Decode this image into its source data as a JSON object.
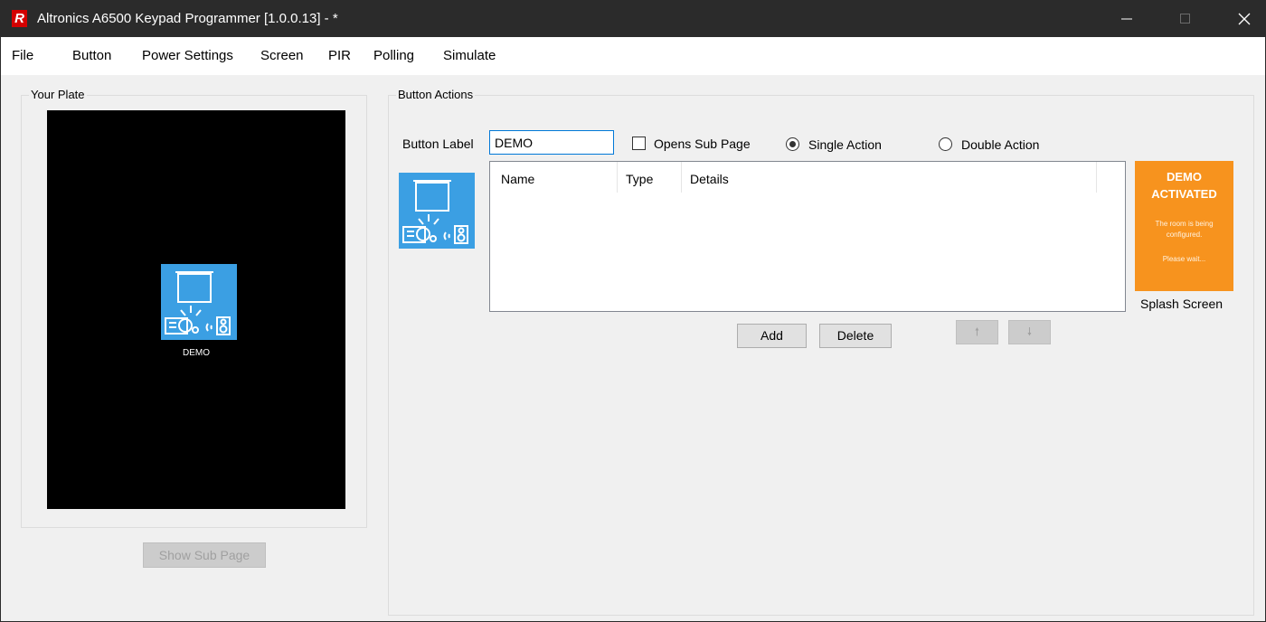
{
  "window": {
    "title": "Altronics A6500 Keypad Programmer [1.0.0.13]  - *",
    "app_icon_letter": "R"
  },
  "menu": [
    "File",
    "Button",
    "Power Settings",
    "Screen",
    "PIR",
    "Polling",
    "Simulate"
  ],
  "your_plate": {
    "title": "Your Plate",
    "button_label": "DEMO",
    "show_sub_page_label": "Show Sub Page",
    "show_sub_page_enabled": false
  },
  "button_actions": {
    "title": "Button Actions",
    "button_label_caption": "Button Label",
    "button_label_value": "DEMO",
    "opens_sub_page_label": "Opens Sub Page",
    "opens_sub_page_checked": false,
    "single_action_label": "Single Action",
    "double_action_label": "Double Action",
    "selected_action": "Single Action",
    "table_columns": [
      "Name",
      "Type",
      "Details"
    ],
    "table_rows": [],
    "add_label": "Add",
    "delete_label": "Delete",
    "up_arrow": "🠕",
    "down_arrow": "🠗"
  },
  "splash": {
    "title_line1": "DEMO",
    "title_line2": "ACTIVATED",
    "body_line1": "The room is being",
    "body_line2": "configured.",
    "wait_text": "Please wait...",
    "caption": "Splash Screen",
    "color": "#f7931e"
  },
  "icon_names": {
    "button_icon": "projector-screen-speaker-icon",
    "minimize": "minimize-icon",
    "maximize": "maximize-icon",
    "close": "close-icon"
  },
  "colors": {
    "tile": "#3b9fe3",
    "titlebar": "#2b2b2b",
    "plate": "#000000",
    "focus_border": "#0078d7"
  }
}
